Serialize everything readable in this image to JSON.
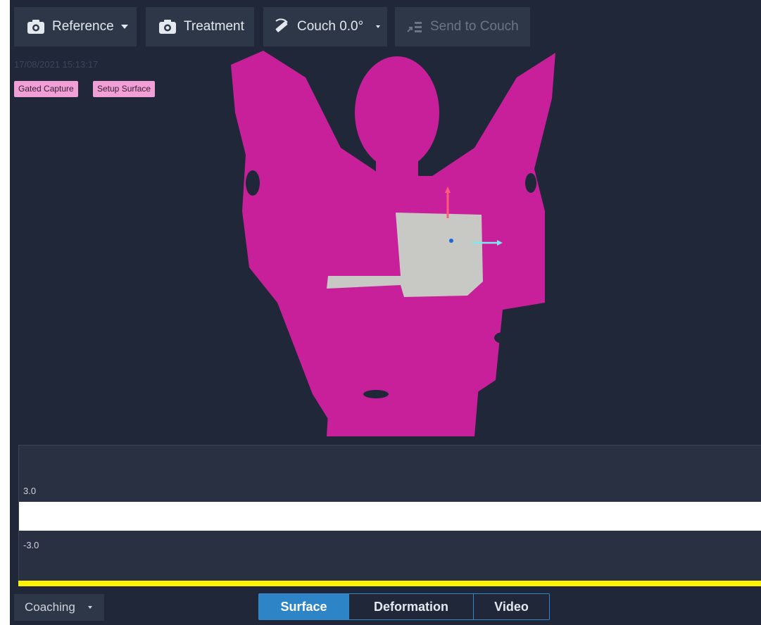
{
  "toolbar": {
    "reference_label": "Reference",
    "treatment_label": "Treatment",
    "couch_label": "Couch 0.0°",
    "send_label": "Send to Couch"
  },
  "capture": {
    "timestamp": "17/08/2021 15:13:17",
    "tags": [
      "Gated Capture",
      "Setup Surface"
    ]
  },
  "graph": {
    "upper_label": "3.0",
    "lower_label": "-3.0"
  },
  "bottom": {
    "coaching_label": "Coaching",
    "views": [
      "Surface",
      "Deformation",
      "Video"
    ],
    "active_view": "Surface"
  },
  "colors": {
    "background": "#1f2738",
    "surface_mesh": "#c8209a",
    "roi": "#c8c8c4",
    "tag": "#f0a0d6",
    "active_tab": "#2d84c6",
    "tolerance_line": "#fff200"
  }
}
